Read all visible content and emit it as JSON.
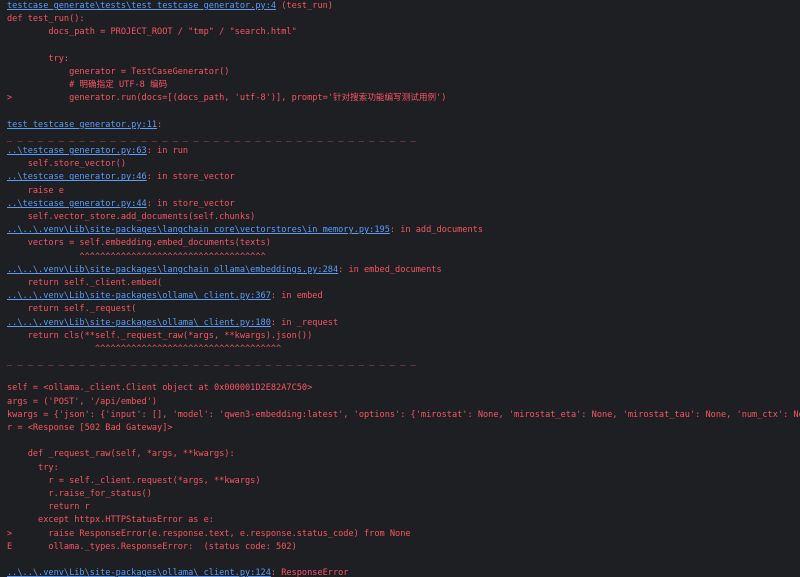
{
  "console": {
    "lines": [
      {
        "link": "testcase_generate\\tests\\test_testcase_generator.py:4",
        "text": " (test_run)"
      },
      {
        "text": "def test_run():"
      },
      {
        "text": "        docs_path = PROJECT_ROOT / \"tmp\" / \"search.html\""
      },
      {
        "text": ""
      },
      {
        "text": "        try:"
      },
      {
        "text": "            generator = TestCaseGenerator()"
      },
      {
        "text": "            # 明确指定 UTF-8 编码"
      },
      {
        "text": ">           generator.run(docs=[(docs_path, 'utf-8')], prompt='针对搜索功能编写测试用例')"
      },
      {
        "text": ""
      },
      {
        "link": "test_testcase_generator.py:11",
        "text": ":"
      },
      {
        "text": "_ _ _ _ _ _ _ _ _ _ _ _ _ _ _ _ _ _ _ _ _ _ _ _ _ _ _ _ _ _ _ _ _ _ _ _ _ _ _ _"
      },
      {
        "link": "..\\testcase_generator.py:63",
        "text": ": in run"
      },
      {
        "text": "    self.store_vector()"
      },
      {
        "link": "..\\testcase_generator.py:46",
        "text": ": in store_vector"
      },
      {
        "text": "    raise e"
      },
      {
        "link": "..\\testcase_generator.py:44",
        "text": ": in store_vector"
      },
      {
        "text": "    self.vector_store.add_documents(self.chunks)"
      },
      {
        "link": "..\\..\\.venv\\Lib\\site-packages\\langchain_core\\vectorstores\\in_memory.py:195",
        "text": ": in add_documents"
      },
      {
        "text": "    vectors = self.embedding.embed_documents(texts)"
      },
      {
        "text": "              ^^^^^^^^^^^^^^^^^^^^^^^^^^^^^^^^^^^^"
      },
      {
        "link": "..\\..\\.venv\\Lib\\site-packages\\langchain_ollama\\embeddings.py:284",
        "text": ": in embed_documents"
      },
      {
        "text": "    return self._client.embed("
      },
      {
        "link": "..\\..\\.venv\\Lib\\site-packages\\ollama\\_client.py:367",
        "text": ": in embed"
      },
      {
        "text": "    return self._request("
      },
      {
        "link": "..\\..\\.venv\\Lib\\site-packages\\ollama\\_client.py:180",
        "text": ": in _request"
      },
      {
        "text": "    return cls(**self._request_raw(*args, **kwargs).json())"
      },
      {
        "text": "                 ^^^^^^^^^^^^^^^^^^^^^^^^^^^^^^^^^^^^"
      },
      {
        "text": "_ _ _ _ _ _ _ _ _ _ _ _ _ _ _ _ _ _ _ _ _ _ _ _ _ _ _ _ _ _ _ _ _ _ _ _ _ _ _ _"
      },
      {
        "text": ""
      },
      {
        "text": "self = <ollama._client.Client object at 0x000001D2E82A7C50>"
      },
      {
        "text": "args = ('POST', '/api/embed')"
      },
      {
        "text": "kwargs = {'json': {'input': [], 'model': 'qwen3-embedding:latest', 'options': {'mirostat': None, 'mirostat_eta': None, 'mirostat_tau': None, 'num_ctx': None, ...}}}"
      },
      {
        "text": "r = <Response [502 Bad Gateway]>"
      },
      {
        "text": ""
      },
      {
        "text": "    def _request_raw(self, *args, **kwargs):"
      },
      {
        "text": "      try:"
      },
      {
        "text": "        r = self._client.request(*args, **kwargs)"
      },
      {
        "text": "        r.raise_for_status()"
      },
      {
        "text": "        return r"
      },
      {
        "text": "      except httpx.HTTPStatusError as e:"
      },
      {
        "text": ">       raise ResponseError(e.response.text, e.response.status_code) from None"
      },
      {
        "text": "E       ollama._types.ResponseError:  (status code: 502)"
      },
      {
        "text": ""
      },
      {
        "link": "..\\..\\.venv\\Lib\\site-packages\\ollama\\_client.py:124",
        "text": ": ResponseError"
      }
    ]
  }
}
